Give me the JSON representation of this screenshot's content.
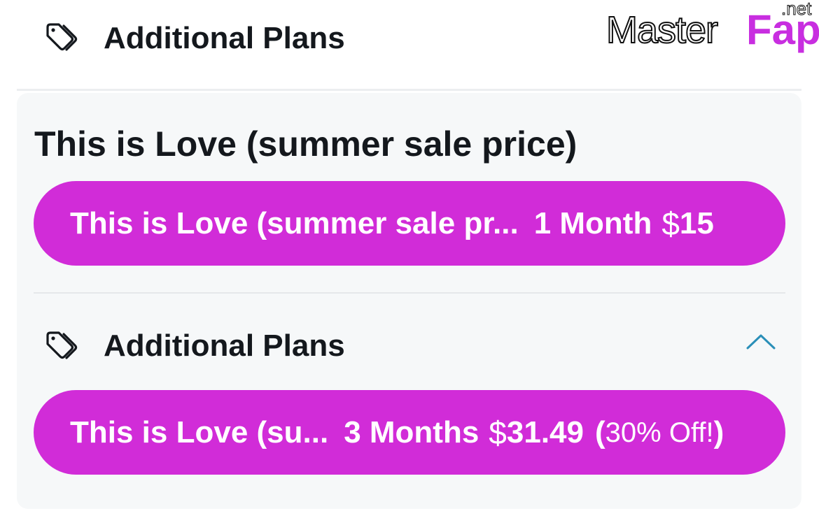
{
  "header": {
    "title": "Additional Plans",
    "icon": "tag-icon"
  },
  "watermark": {
    "part1": "Master",
    "part2": "Fap",
    "part3": ".net"
  },
  "plan": {
    "title": "This is Love (summer sale price)"
  },
  "options": [
    {
      "name": "This is Love (summer sale pr...",
      "duration": "1 Month",
      "currency": "$",
      "amount": "15"
    },
    {
      "name": "This is Love (su...",
      "duration": "3 Months",
      "currency": "$",
      "amount": "31.49",
      "paren_open": "(",
      "discount": "30% Off!",
      "paren_close": ")"
    }
  ],
  "additional_section": {
    "title": "Additional Plans",
    "icon": "tag-icon",
    "toggle_icon": "chevron-up-icon"
  },
  "colors": {
    "accent": "#d12cd8",
    "heading": "#14181d",
    "card_bg": "#f6f8f9",
    "chevron": "#2a8fb8"
  }
}
